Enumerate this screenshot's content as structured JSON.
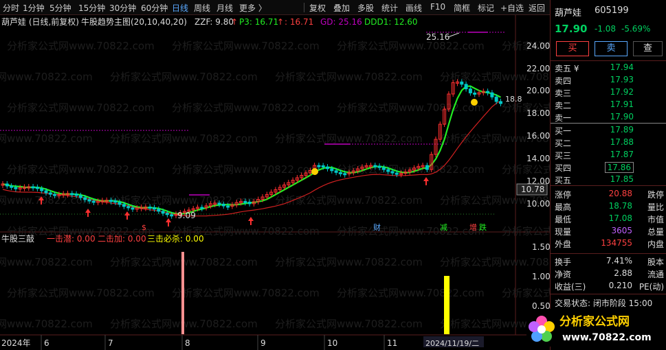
{
  "toolbar": {
    "left": [
      "分时",
      "1分钟",
      "5分钟",
      "15分钟",
      "30分钟",
      "60分钟",
      "日线",
      "周线",
      "月线",
      "更多 〉"
    ],
    "active": "日线",
    "right": [
      "复权",
      "叠加",
      "多股",
      "统计",
      "画线",
      "F10",
      "简框",
      "标记",
      "+自选",
      "返回"
    ]
  },
  "header": {
    "stock_name": "葫芦娃 (日线,前复权)",
    "indicator": "牛股趋势主图(20,10,40,20)",
    "zzf": "ZZF: 9.80",
    "p3": "P3: 16.71",
    "p3b": ": 16.71",
    "gd": "GD: 25.16",
    "ddd1": "DDD1: 12.60"
  },
  "sub_header": {
    "name": "牛股三敲",
    "a": "一击潜: 0.00",
    "b": "二击加: 0.00",
    "c": "三击必杀: 0.00"
  },
  "axis": {
    "y_main": [
      "24.00",
      "22.00",
      "20.00",
      "18.00",
      "16.00",
      "14.00",
      "12.00",
      "10.00"
    ],
    "y_sub": [
      "1.50",
      "1.00",
      "0.50"
    ],
    "current_price_tag": "10.78",
    "x_labels": [
      "2024年",
      "6",
      "7",
      "8",
      "9",
      "10",
      "11",
      "2024/11/19/二"
    ]
  },
  "annotations": {
    "high": "25.16",
    "low": "9.09",
    "right_mark": "18.8",
    "events": [
      "财",
      "减",
      "增",
      "跌"
    ]
  },
  "watermark": "分析家公式网www.70822.com",
  "panel": {
    "name": "葫芦娃",
    "code": "605199",
    "price": "17.90",
    "change": "-1.08",
    "change_pct": "-5.69%",
    "buttons": [
      "买",
      "卖",
      "查"
    ],
    "asks": [
      {
        "label": "卖五 ¥",
        "price": "17.94"
      },
      {
        "label": "卖四",
        "price": "17.93"
      },
      {
        "label": "卖三",
        "price": "17.92"
      },
      {
        "label": "卖二",
        "price": "17.91"
      },
      {
        "label": "卖一",
        "price": "17.90"
      }
    ],
    "bids": [
      {
        "label": "买一",
        "price": "17.89"
      },
      {
        "label": "买二",
        "price": "17.88"
      },
      {
        "label": "买三",
        "price": "17.87"
      },
      {
        "label": "买四",
        "price": "17.86"
      },
      {
        "label": "买五",
        "price": "17.85"
      }
    ],
    "stats": [
      {
        "l": "涨停",
        "v": "20.88",
        "c": "#ff4040",
        "r": "跌停"
      },
      {
        "l": "最高",
        "v": "18.78",
        "c": "#00d060",
        "r": "量比"
      },
      {
        "l": "最低",
        "v": "17.08",
        "c": "#00d060",
        "r": "市值"
      },
      {
        "l": "现量",
        "v": "3605",
        "c": "#c060ff",
        "r": "总量"
      },
      {
        "l": "外盘",
        "v": "134755",
        "c": "#ff4040",
        "r": "内盘"
      }
    ],
    "stats2": [
      {
        "l": "换手",
        "v": "7.41%",
        "r": "股本"
      },
      {
        "l": "净资",
        "v": "2.88",
        "r": "流通"
      },
      {
        "l": "收益(三)",
        "v": "0.210",
        "r": "PE(动)"
      }
    ],
    "trade_status": "交易状态: 闭市阶段 15:00"
  },
  "logo": {
    "text": "分析家公式网",
    "url": "www.70822.com"
  },
  "colors": {
    "up": "#ff3030",
    "down": "#00c8c8",
    "ma_green": "#22ee22",
    "ma_red": "#d02020",
    "purple": "#c000c0",
    "yellow": "#ffff00",
    "pink": "#ff9090"
  }
}
